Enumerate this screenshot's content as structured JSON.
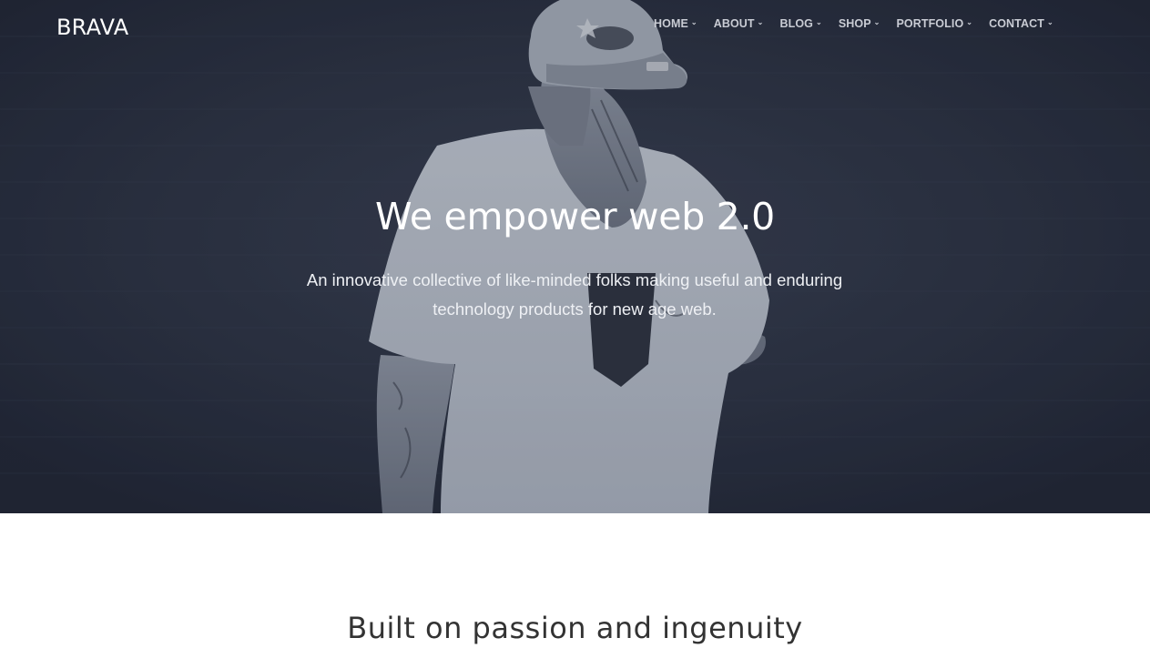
{
  "brand": {
    "name": "BRAVA"
  },
  "nav": {
    "items": [
      {
        "label": "HOME"
      },
      {
        "label": "ABOUT"
      },
      {
        "label": "BLOG"
      },
      {
        "label": "SHOP"
      },
      {
        "label": "PORTFOLIO"
      },
      {
        "label": "CONTACT"
      }
    ]
  },
  "hero": {
    "title": "We empower web 2.0",
    "subtitle": "An innovative collective of like-minded folks making useful and enduring technology products for new age web."
  },
  "section": {
    "heading": "Built on passion and ingenuity"
  },
  "colors": {
    "hero_bg": "#2b3140",
    "nav_text": "#c9ccd4",
    "hero_text": "#ffffff"
  }
}
